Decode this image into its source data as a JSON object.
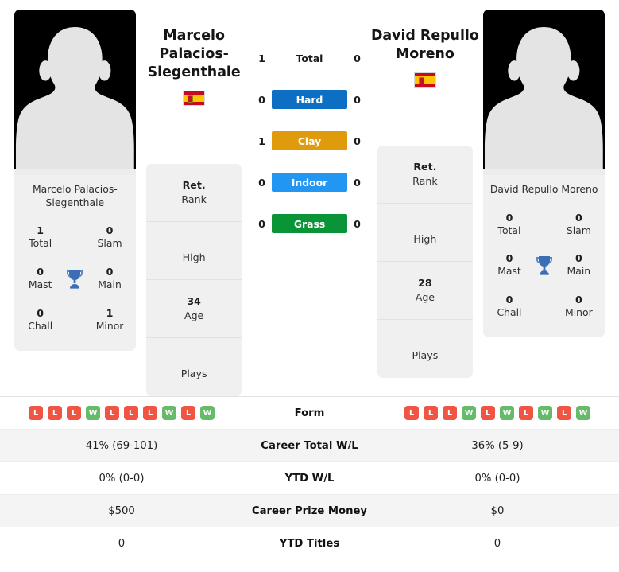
{
  "players": {
    "left": {
      "name": "Marcelo Palacios-Siegenthale",
      "photo_caption": "Marcelo Palacios-Siegenthale",
      "country": "Spain",
      "flag_icon": "spain-flag-icon",
      "avatar_icon": "player-photo-placeholder-icon",
      "titles": {
        "total_value": "1",
        "total_label": "Total",
        "slam_value": "0",
        "slam_label": "Slam",
        "mast_value": "0",
        "mast_label": "Mast",
        "main_value": "0",
        "main_label": "Main",
        "chall_value": "0",
        "chall_label": "Chall",
        "minor_value": "1",
        "minor_label": "Minor",
        "trophy_icon": "trophy-icon"
      },
      "info": {
        "rank_value": "Ret.",
        "rank_label": "Rank",
        "high_value": "",
        "high_label": "High",
        "age_value": "34",
        "age_label": "Age",
        "plays_value": "",
        "plays_label": "Plays"
      },
      "surface_scores": {
        "total": "1",
        "hard": "0",
        "clay": "1",
        "indoor": "0",
        "grass": "0"
      },
      "form": [
        "L",
        "L",
        "L",
        "W",
        "L",
        "L",
        "L",
        "W",
        "L",
        "W"
      ],
      "career_total_wl": "41% (69-101)",
      "ytd_wl": "0% (0-0)",
      "career_prize_money": "$500",
      "ytd_titles": "0"
    },
    "right": {
      "name": "David Repullo Moreno",
      "photo_caption": "David Repullo Moreno",
      "country": "Spain",
      "flag_icon": "spain-flag-icon",
      "avatar_icon": "player-photo-placeholder-icon",
      "titles": {
        "total_value": "0",
        "total_label": "Total",
        "slam_value": "0",
        "slam_label": "Slam",
        "mast_value": "0",
        "mast_label": "Mast",
        "main_value": "0",
        "main_label": "Main",
        "chall_value": "0",
        "chall_label": "Chall",
        "minor_value": "0",
        "minor_label": "Minor",
        "trophy_icon": "trophy-icon"
      },
      "info": {
        "rank_value": "Ret.",
        "rank_label": "Rank",
        "high_value": "",
        "high_label": "High",
        "age_value": "28",
        "age_label": "Age",
        "plays_value": "",
        "plays_label": "Plays"
      },
      "surface_scores": {
        "total": "0",
        "hard": "0",
        "clay": "0",
        "indoor": "0",
        "grass": "0"
      },
      "form": [
        "L",
        "L",
        "L",
        "W",
        "L",
        "W",
        "L",
        "W",
        "L",
        "W"
      ],
      "career_total_wl": "36% (5-9)",
      "ytd_wl": "0% (0-0)",
      "career_prize_money": "$0",
      "ytd_titles": "0"
    }
  },
  "surfaces": [
    {
      "key": "total",
      "label": "Total",
      "color": "transparent",
      "has_bar": false
    },
    {
      "key": "hard",
      "label": "Hard",
      "color": "#0c6fc4",
      "has_bar": true
    },
    {
      "key": "clay",
      "label": "Clay",
      "color": "#e09b0c",
      "has_bar": true
    },
    {
      "key": "indoor",
      "label": "Indoor",
      "color": "#2196f3",
      "has_bar": true
    },
    {
      "key": "grass",
      "label": "Grass",
      "color": "#0a9438",
      "has_bar": true
    }
  ],
  "stats_rows": [
    {
      "label": "Form",
      "type": "form"
    },
    {
      "label": "Career Total W/L",
      "type": "text",
      "key": "career_total_wl"
    },
    {
      "label": "YTD W/L",
      "type": "text",
      "key": "ytd_wl"
    },
    {
      "label": "Career Prize Money",
      "type": "text",
      "key": "career_prize_money"
    },
    {
      "label": "YTD Titles",
      "type": "text",
      "key": "ytd_titles"
    }
  ],
  "colors": {
    "hard": "#0c6fc4",
    "clay": "#e09b0c",
    "indoor": "#2196f3",
    "grass": "#0a9438",
    "win_badge": "#66bb6a",
    "loss_badge": "#ef5542",
    "trophy": "#3b6eb4",
    "card_bg": "#f0f0f0"
  }
}
